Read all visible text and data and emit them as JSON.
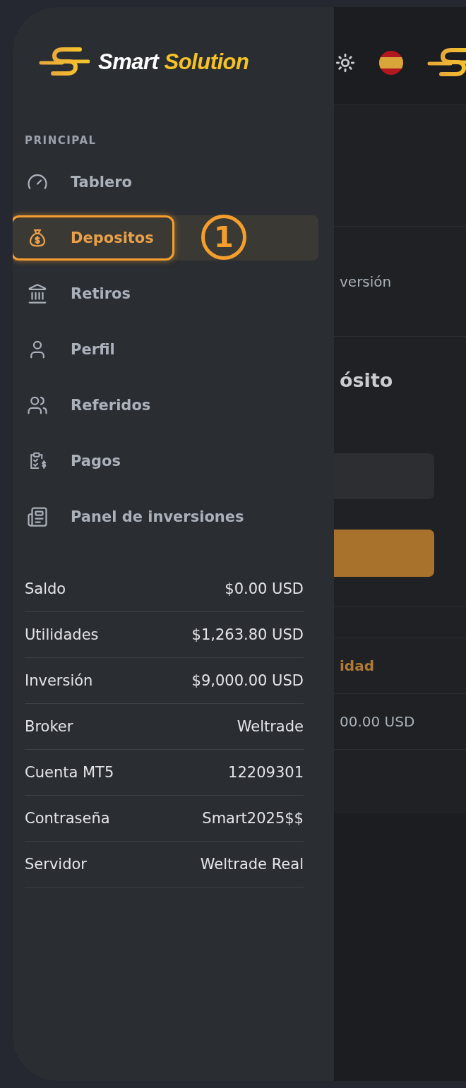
{
  "sidebar": {
    "brand": {
      "first": "Smart",
      "second": "Solution"
    },
    "section_title": "PRINCIPAL",
    "items": [
      {
        "label": "Tablero",
        "selected": false
      },
      {
        "label": "Depositos",
        "selected": true,
        "annotation": "1"
      },
      {
        "label": "Retiros",
        "selected": false
      },
      {
        "label": "Perfil",
        "selected": false
      },
      {
        "label": "Referidos",
        "selected": false
      },
      {
        "label": "Pagos",
        "selected": false
      },
      {
        "label": "Panel de inversiones",
        "selected": false
      }
    ],
    "stats": [
      {
        "label": "Saldo",
        "value": "$0.00 USD"
      },
      {
        "label": "Utilidades",
        "value": "$1,263.80 USD"
      },
      {
        "label": "Inversión",
        "value": "$9,000.00 USD"
      },
      {
        "label": "Broker",
        "value": "Weltrade"
      },
      {
        "label": "Cuenta MT5",
        "value": "12209301"
      },
      {
        "label": "Contraseña",
        "value": "Smart2025$$"
      },
      {
        "label": "Servidor",
        "value": "Weltrade Real"
      }
    ]
  },
  "main": {
    "tab_label": "versión",
    "card_title": "ósito",
    "table": {
      "column_header": "idad",
      "cell": "00.00 USD"
    }
  }
}
